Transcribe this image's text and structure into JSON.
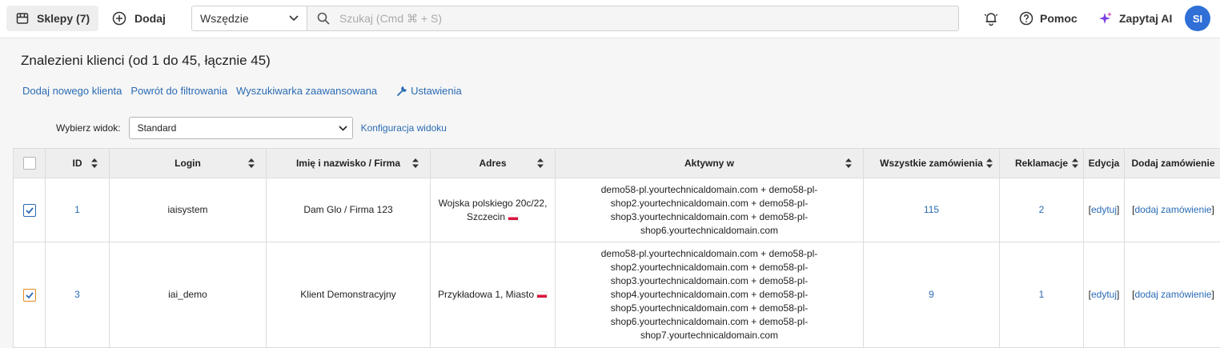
{
  "topbar": {
    "shops_label": "Sklepy (7)",
    "add_label": "Dodaj",
    "scope_value": "Wszędzie",
    "search_placeholder": "Szukaj (Cmd ⌘ + S)",
    "help_label": "Pomoc",
    "ai_label": "Zapytaj AI",
    "avatar_initials": "SI"
  },
  "page": {
    "title": "Znalezieni klienci (od 1 do 45, łącznie 45)",
    "links": {
      "add_client": "Dodaj nowego klienta",
      "back_to_filter": "Powrót do filtrowania",
      "advanced_search": "Wyszukiwarka zaawansowana",
      "settings": "Ustawienia"
    },
    "view": {
      "label": "Wybierz widok:",
      "selected": "Standard",
      "config_link": "Konfiguracja widoku"
    }
  },
  "table": {
    "headers": {
      "id": "ID",
      "login": "Login",
      "name": "Imię i nazwisko / Firma",
      "address": "Adres",
      "active": "Aktywny w",
      "orders": "Wszystkie zamówienia",
      "complaints": "Reklamacje",
      "edit": "Edycja",
      "add_order": "Dodaj zamówienie"
    },
    "rows": [
      {
        "checked": true,
        "id": "1",
        "login": "iaisystem",
        "name": "Dam Glo / Firma 123",
        "address": "Wojska polskiego 20c/22, Szczecin",
        "active": "demo58-pl.yourtechnicaldomain.com + demo58-pl-shop2.yourtechnicaldomain.com + demo58-pl-shop3.yourtechnicaldomain.com + demo58-pl-shop6.yourtechnicaldomain.com",
        "orders": "115",
        "complaints": "2",
        "edit": "edytuj",
        "add_order": "dodaj zamówienie"
      },
      {
        "checked": true,
        "id": "3",
        "login": "iai_demo",
        "name": "Klient Demonstracyjny",
        "address": "Przykładowa 1, Miasto",
        "active": "demo58-pl.yourtechnicaldomain.com + demo58-pl-shop2.yourtechnicaldomain.com + demo58-pl-shop3.yourtechnicaldomain.com + demo58-pl-shop4.yourtechnicaldomain.com + demo58-pl-shop5.yourtechnicaldomain.com + demo58-pl-shop6.yourtechnicaldomain.com + demo58-pl-shop7.yourtechnicaldomain.com",
        "orders": "9",
        "complaints": "1",
        "edit": "edytuj",
        "add_order": "dodaj zamówienie"
      }
    ]
  },
  "colors": {
    "link": "#2a6bb3",
    "avatar": "#2f6fd6",
    "checkbox_mark": "#2a6bb3"
  }
}
